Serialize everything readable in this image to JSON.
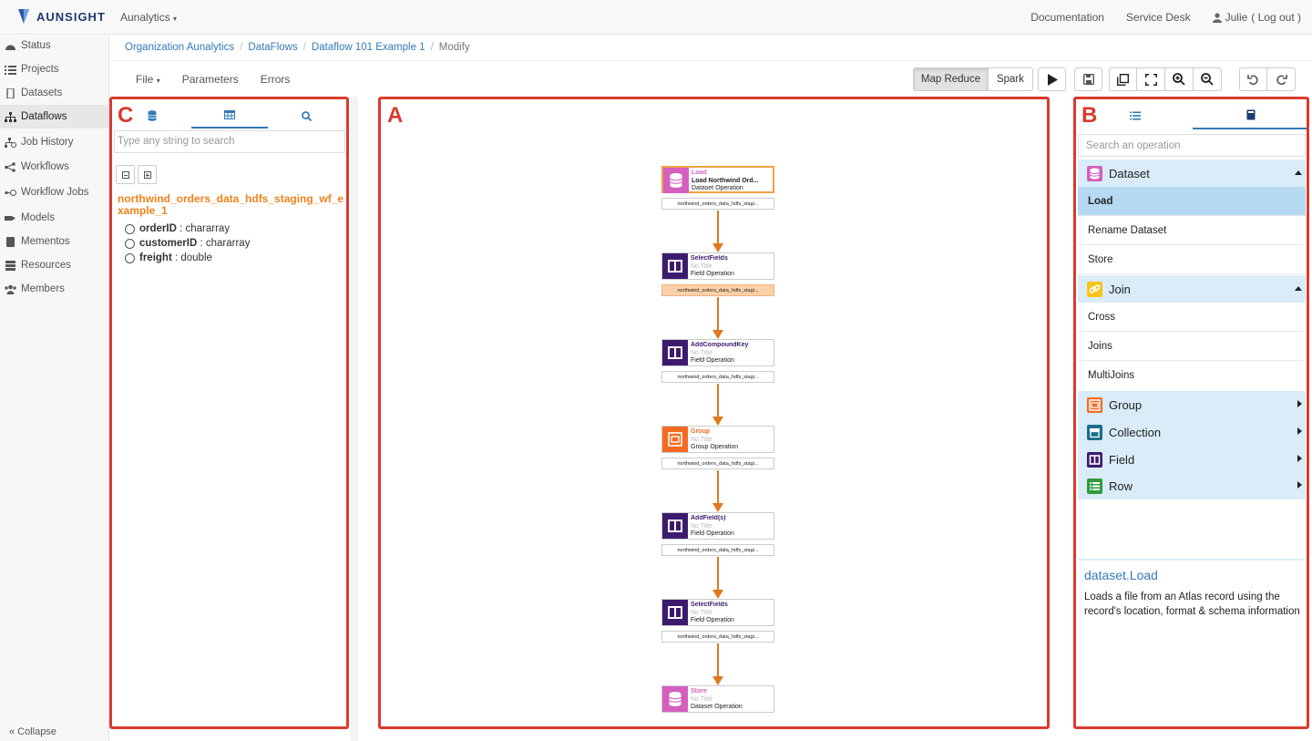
{
  "brand": {
    "name": "AUNSIGHT"
  },
  "org_switch": "Aunalytics",
  "topnav": {
    "documentation": "Documentation",
    "service_desk": "Service Desk",
    "user": "Julie",
    "logout": "( Log out )"
  },
  "sidebar": {
    "items": [
      {
        "label": "Status",
        "icon": "dashboard-icon"
      },
      {
        "label": "Projects",
        "icon": "list-icon"
      },
      {
        "label": "Datasets",
        "icon": "file-icon"
      },
      {
        "label": "Dataflows",
        "icon": "sitemap-icon",
        "active": true
      },
      {
        "label": "Job History",
        "icon": "sitemap-clock-icon"
      },
      {
        "label": "Workflows",
        "icon": "workflow-icon"
      },
      {
        "label": "Workflow Jobs",
        "icon": "workflow-clock-icon"
      },
      {
        "label": "Models",
        "icon": "model-icon"
      },
      {
        "label": "Mementos",
        "icon": "memento-icon"
      },
      {
        "label": "Resources",
        "icon": "server-icon"
      },
      {
        "label": "Members",
        "icon": "users-icon"
      }
    ],
    "collapse": "« Collapse"
  },
  "breadcrumb": [
    "Organization Aunalytics",
    "DataFlows",
    "Dataflow 101 Example 1",
    "Modify"
  ],
  "toolbar": {
    "file": "File",
    "parameters": "Parameters",
    "errors": "Errors",
    "engines": [
      "Map Reduce",
      "Spark"
    ],
    "selected_engine": "Map Reduce"
  },
  "annotations": {
    "a": "A",
    "b": "B",
    "c": "C"
  },
  "panel_c": {
    "search_placeholder": "Type any string to search",
    "dataset_name": "northwind_orders_data_hdfs_staging_wf_example_1",
    "fields": [
      {
        "name": "orderID",
        "type": " : chararray"
      },
      {
        "name": "customerID",
        "type": " : chararray"
      },
      {
        "name": "freight",
        "type": " : double"
      }
    ]
  },
  "flow": {
    "nodes": [
      {
        "kind": "Load",
        "title": "Load Northwind Ord...",
        "type": "Dataset Operation",
        "port": "northwind_orders_data_hdfs_stagi...",
        "color": "#d45fbf",
        "icon": "database-icon"
      },
      {
        "kind": "SelectFields",
        "title": "No Title",
        "type": "Field Operation",
        "port": "northwind_orders_data_hdfs_stagi...",
        "color": "#3d1a6e",
        "icon": "columns-icon"
      },
      {
        "kind": "AddCompoundKey",
        "title": "No Title",
        "type": "Field Operation",
        "port": "northwind_orders_data_hdfs_stagi...",
        "color": "#3d1a6e",
        "icon": "columns-icon"
      },
      {
        "kind": "Group",
        "title": "No Title",
        "type": "Group Operation",
        "port": "northwind_orders_data_hdfs_stagi...",
        "color": "#f26b21",
        "icon": "group-icon"
      },
      {
        "kind": "AddField(s)",
        "title": "No Title",
        "type": "Field Operation",
        "port": "northwind_orders_data_hdfs_stagi...",
        "color": "#3d1a6e",
        "icon": "columns-icon"
      },
      {
        "kind": "SelectFields",
        "title": "No Title",
        "type": "Field Operation",
        "port": "northwind_orders_data_hdfs_stagi...",
        "color": "#3d1a6e",
        "icon": "columns-icon"
      },
      {
        "kind": "Store",
        "title": "No Title",
        "type": "Dataset Operation",
        "color": "#d45fbf",
        "icon": "database-icon"
      }
    ]
  },
  "panel_b": {
    "search_placeholder": "Search an operation",
    "categories": {
      "dataset": {
        "label": "Dataset",
        "ops": [
          "Load",
          "Rename Dataset",
          "Store"
        ],
        "color": "#d45fbf"
      },
      "join": {
        "label": "Join",
        "ops": [
          "Cross",
          "Joins",
          "MultiJoins"
        ],
        "color": "#f5c518"
      },
      "group": {
        "label": "Group",
        "color": "#f26b21"
      },
      "collection": {
        "label": "Collection",
        "color": "#1b6e8a"
      },
      "field": {
        "label": "Field",
        "color": "#3d1a6e"
      },
      "row": {
        "label": "Row",
        "color": "#2e9c3a"
      }
    },
    "selected_op": "Load",
    "doc_title": "dataset.Load",
    "doc_body": "Loads a file from an Atlas record using the record's location, format & schema information"
  }
}
